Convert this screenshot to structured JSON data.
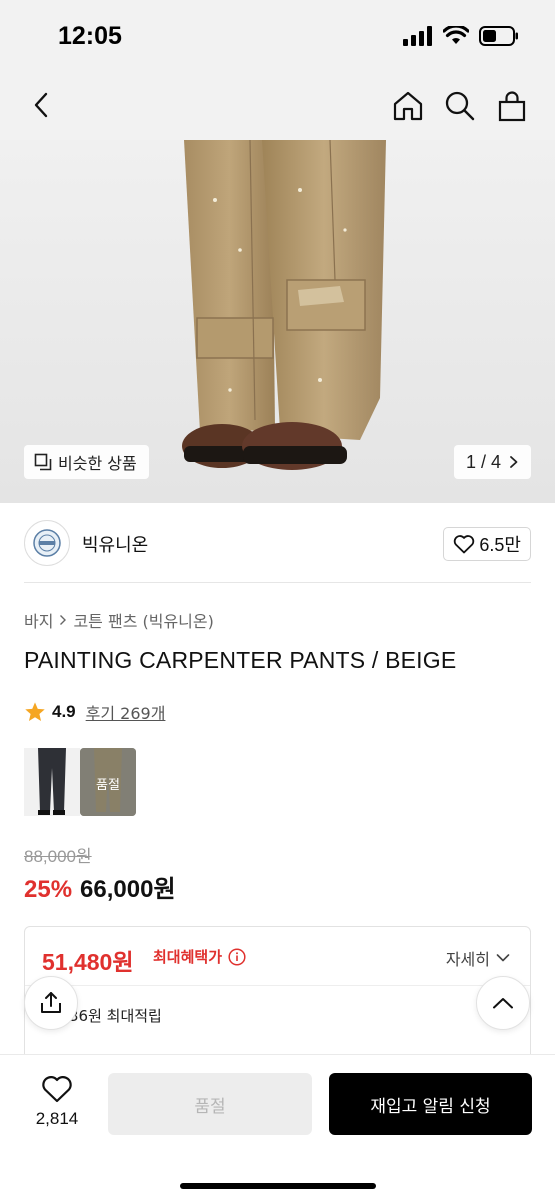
{
  "status_bar": {
    "time": "12:05"
  },
  "image_overlay": {
    "similar_label": "비슷한 상품",
    "page_indicator": "1 / 4"
  },
  "brand": {
    "name": "빅유니온",
    "likes": "6.5만"
  },
  "breadcrumb": {
    "category": "바지",
    "sub_category": "코튼 팬츠 (빅유니온)"
  },
  "product": {
    "title": "PAINTING CARPENTER PANTS / BEIGE",
    "rating": "4.9",
    "reviews": "후기 269개",
    "soldout_swatch_label": "품절",
    "original_price": "88,000원",
    "discount": "25%",
    "sale_price": "66,000원"
  },
  "benefit": {
    "max_price": "51,480원",
    "max_label": "최대혜택가",
    "detail_label": "자세히",
    "points_text": "36원 최대적립"
  },
  "bottom_bar": {
    "wish_count": "2,814",
    "soldout_label": "품절",
    "restock_label": "재입고 알림 신청"
  },
  "colors": {
    "accent_red": "#e0312e",
    "star": "#f5a623",
    "primary_button": "#000000"
  },
  "icons": [
    "back-icon",
    "home-icon",
    "search-icon",
    "bag-icon",
    "similar-icon",
    "chevron-right-icon",
    "heart-icon",
    "star-icon",
    "info-icon",
    "chevron-down-icon",
    "share-icon",
    "chevron-up-icon"
  ]
}
